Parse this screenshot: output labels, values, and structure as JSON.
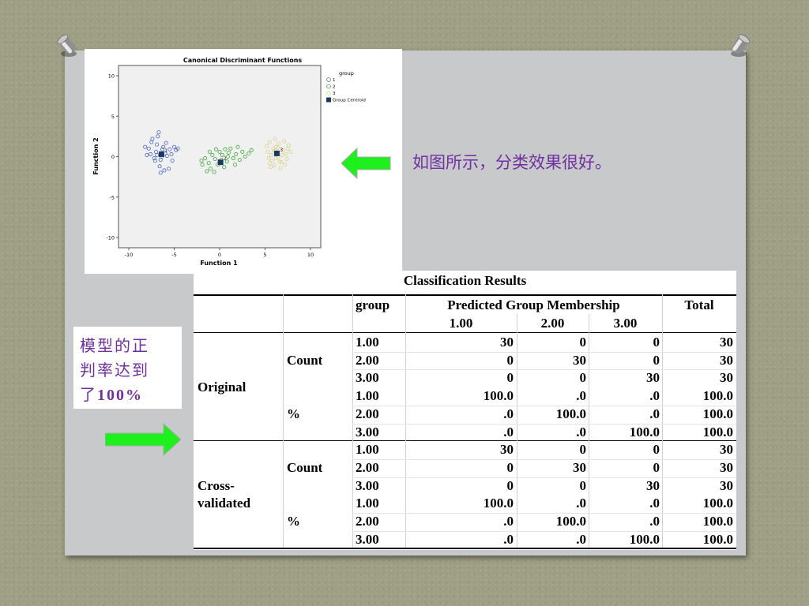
{
  "colors": {
    "caption": "#7030a0",
    "arrow": "#22ee22",
    "group1": "#4a64c8",
    "group2": "#3aa83a",
    "group3": "#d8d28a",
    "centroid": "#1a3a5c"
  },
  "caption_top": "如图所示，分类效果很好。",
  "caption_side": {
    "line1": "模型的正",
    "line2": "判率达到",
    "line3_prefix": "了",
    "line3_value": "100%"
  },
  "plot": {
    "title": "Canonical Discriminant Functions",
    "xlabel": "Function 1",
    "ylabel": "Function 2",
    "x_ticks": [
      "-10",
      "-5",
      "0",
      "5",
      "10"
    ],
    "y_ticks": [
      "10",
      "5",
      "0",
      "-5",
      "-10"
    ],
    "legend_title": "group",
    "legend_items": [
      "1",
      "2",
      "3",
      "Group Centroid"
    ],
    "centroid_labels": [
      "1",
      "2",
      "3"
    ]
  },
  "chart_data": {
    "type": "scatter",
    "title": "Canonical Discriminant Functions",
    "xlabel": "Function 1",
    "ylabel": "Function 2",
    "xlim": [
      -10,
      10
    ],
    "ylim": [
      -10,
      10
    ],
    "legend_title": "group",
    "series": [
      {
        "name": "1",
        "points": [
          [
            -7.5,
            1.8
          ],
          [
            -6.8,
            2.5
          ],
          [
            -6.2,
            1.2
          ],
          [
            -7.0,
            0.6
          ],
          [
            -8.0,
            0.2
          ],
          [
            -6.5,
            -0.4
          ],
          [
            -5.5,
            0.9
          ],
          [
            -7.8,
            1.0
          ],
          [
            -6.0,
            0.4
          ],
          [
            -5.2,
            -0.5
          ],
          [
            -6.6,
            -1.2
          ],
          [
            -7.2,
            -0.2
          ],
          [
            -4.8,
            0.8
          ],
          [
            -6.9,
            1.5
          ],
          [
            -5.9,
            1.7
          ],
          [
            -8.2,
            1.2
          ],
          [
            -5.0,
            1.2
          ],
          [
            -6.4,
            0.0
          ],
          [
            -7.6,
            0.3
          ],
          [
            -6.1,
            -1.7
          ],
          [
            -5.6,
            -1.5
          ],
          [
            -7.4,
            2.2
          ],
          [
            -6.7,
            3.0
          ],
          [
            -5.3,
            0.3
          ],
          [
            -6.3,
            0.9
          ],
          [
            -7.1,
            -0.5
          ],
          [
            -5.8,
            0.1
          ],
          [
            -6.9,
            0.2
          ],
          [
            -4.6,
            1.0
          ],
          [
            -6.5,
            -2.0
          ]
        ]
      },
      {
        "name": "2",
        "points": [
          [
            -2.0,
            -0.5
          ],
          [
            -1.2,
            -0.8
          ],
          [
            -0.5,
            -0.3
          ],
          [
            0.3,
            0.2
          ],
          [
            1.0,
            0.5
          ],
          [
            1.8,
            0.3
          ],
          [
            2.5,
            0.6
          ],
          [
            -1.0,
            -1.5
          ],
          [
            -0.2,
            -1.0
          ],
          [
            0.8,
            -0.6
          ],
          [
            1.5,
            -0.2
          ],
          [
            -1.6,
            -0.2
          ],
          [
            0.0,
            0.6
          ],
          [
            2.2,
            -0.4
          ],
          [
            -0.8,
            0.2
          ],
          [
            0.5,
            -1.3
          ],
          [
            1.2,
            1.0
          ],
          [
            -1.4,
            -1.8
          ],
          [
            2.8,
            0.0
          ],
          [
            -0.4,
            0.9
          ],
          [
            3.2,
            0.4
          ],
          [
            0.9,
            0.0
          ],
          [
            -1.9,
            -1.0
          ],
          [
            1.7,
            -1.0
          ],
          [
            0.2,
            -0.4
          ],
          [
            -1.1,
            0.6
          ],
          [
            2.0,
            1.2
          ],
          [
            -0.6,
            -1.9
          ],
          [
            3.5,
            0.8
          ],
          [
            0.6,
            0.9
          ]
        ]
      },
      {
        "name": "3",
        "points": [
          [
            5.5,
            1.8
          ],
          [
            6.2,
            1.2
          ],
          [
            7.0,
            0.8
          ],
          [
            6.5,
            0.0
          ],
          [
            5.8,
            -0.5
          ],
          [
            7.3,
            0.3
          ],
          [
            6.0,
            -1.1
          ],
          [
            5.3,
            0.6
          ],
          [
            7.6,
            1.4
          ],
          [
            6.8,
            -0.7
          ],
          [
            5.6,
            -1.3
          ],
          [
            7.1,
            1.9
          ],
          [
            6.3,
            0.5
          ],
          [
            5.9,
            1.0
          ],
          [
            6.7,
            -1.4
          ],
          [
            7.4,
            -0.3
          ],
          [
            5.4,
            -0.2
          ],
          [
            6.1,
            2.2
          ],
          [
            7.8,
            0.6
          ],
          [
            6.5,
            1.6
          ],
          [
            5.7,
            0.2
          ],
          [
            6.9,
            0.2
          ],
          [
            6.2,
            -0.2
          ],
          [
            5.2,
            1.3
          ],
          [
            7.2,
            -1.0
          ],
          [
            6.0,
            0.7
          ],
          [
            6.6,
            -0.6
          ],
          [
            5.5,
            -0.8
          ],
          [
            7.5,
            1.0
          ],
          [
            6.4,
            1.1
          ]
        ]
      }
    ],
    "centroids": [
      {
        "group": "1",
        "x": -6.4,
        "y": 0.3
      },
      {
        "group": "2",
        "x": 0.1,
        "y": -0.7
      },
      {
        "group": "3",
        "x": 6.3,
        "y": 0.4
      }
    ]
  },
  "table": {
    "title": "Classification Results",
    "headers": {
      "group": "group",
      "predicted": "Predicted Group Membership",
      "total": "Total",
      "sub": [
        "1.00",
        "2.00",
        "3.00"
      ]
    },
    "sections": [
      {
        "label_line1": "Original",
        "label_line2": "",
        "blocks": [
          {
            "label": "Count",
            "rows": [
              {
                "group": "1.00",
                "v1": "30",
                "v2": "0",
                "v3": "0",
                "total": "30"
              },
              {
                "group": "2.00",
                "v1": "0",
                "v2": "30",
                "v3": "0",
                "total": "30"
              },
              {
                "group": "3.00",
                "v1": "0",
                "v2": "0",
                "v3": "30",
                "total": "30"
              }
            ]
          },
          {
            "label": "%",
            "rows": [
              {
                "group": "1.00",
                "v1": "100.0",
                "v2": ".0",
                "v3": ".0",
                "total": "100.0"
              },
              {
                "group": "2.00",
                "v1": ".0",
                "v2": "100.0",
                "v3": ".0",
                "total": "100.0"
              },
              {
                "group": "3.00",
                "v1": ".0",
                "v2": ".0",
                "v3": "100.0",
                "total": "100.0"
              }
            ]
          }
        ]
      },
      {
        "label_line1": "Cross-",
        "label_line2": "validated",
        "blocks": [
          {
            "label": "Count",
            "rows": [
              {
                "group": "1.00",
                "v1": "30",
                "v2": "0",
                "v3": "0",
                "total": "30"
              },
              {
                "group": "2.00",
                "v1": "0",
                "v2": "30",
                "v3": "0",
                "total": "30"
              },
              {
                "group": "3.00",
                "v1": "0",
                "v2": "0",
                "v3": "30",
                "total": "30"
              }
            ]
          },
          {
            "label": "%",
            "rows": [
              {
                "group": "1.00",
                "v1": "100.0",
                "v2": ".0",
                "v3": ".0",
                "total": "100.0"
              },
              {
                "group": "2.00",
                "v1": ".0",
                "v2": "100.0",
                "v3": ".0",
                "total": "100.0"
              },
              {
                "group": "3.00",
                "v1": ".0",
                "v2": ".0",
                "v3": "100.0",
                "total": "100.0"
              }
            ]
          }
        ]
      }
    ]
  }
}
